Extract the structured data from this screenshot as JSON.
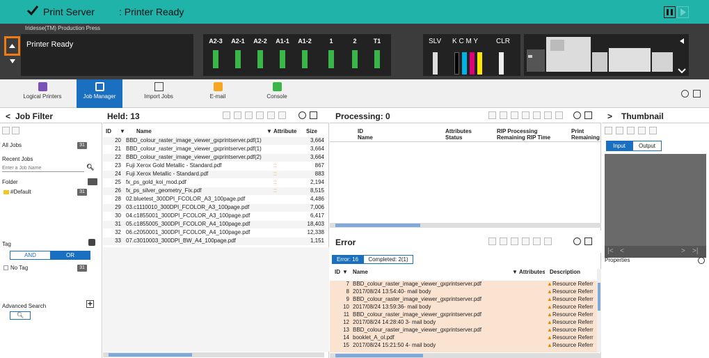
{
  "topbar": {
    "app": "Print Server",
    "status": ": Printer Ready"
  },
  "printer": {
    "model": "Iridesse(TM) Production Press",
    "status": "Printer Ready"
  },
  "trays": [
    "A2-3",
    "A2-1",
    "A2-2",
    "A1-1",
    "A1-2",
    "1",
    "2",
    "T1"
  ],
  "toner": {
    "slv": "SLV",
    "cmyk": "K  C  M  Y",
    "clr": "CLR"
  },
  "tabs": [
    "Logical Printers",
    "Job Manager",
    "Import Jobs",
    "E-mail",
    "Console"
  ],
  "jobfilter": {
    "title": "Job Filter",
    "all_jobs": "All Jobs",
    "all_count": "31",
    "recent": "Recent Jobs",
    "placeholder": "Enter a Job Name",
    "folder": "Folder",
    "default_folder": "#Default",
    "folder_count": "31",
    "tag": "Tag",
    "and": "AND",
    "or": "OR",
    "no_tag": "No Tag",
    "no_tag_count": "31",
    "adv": "Advanced Search"
  },
  "held": {
    "title": "Held: 13",
    "col_id": "ID",
    "col_name": "Name",
    "col_attr": "Attributes",
    "col_size": "Size",
    "rows": [
      {
        "id": "20",
        "name": "BBD_colour_raster_image_viewer_gxprintserver.pdf(1)",
        "attr": "",
        "size": "3,664"
      },
      {
        "id": "21",
        "name": "BBD_colour_raster_image_viewer_gxprintserver.pdf(1)",
        "attr": "",
        "size": "3,664"
      },
      {
        "id": "22",
        "name": "BBD_colour_raster_image_viewer_gxprintserver.pdf(2)",
        "attr": "",
        "size": "3,664"
      },
      {
        "id": "23",
        "name": "Fuji Xerox Gold Metallic - Standard.pdf",
        "attr": "::",
        "size": "867"
      },
      {
        "id": "24",
        "name": "Fuji Xerox Metallic - Standard.pdf",
        "attr": "::",
        "size": "883"
      },
      {
        "id": "25",
        "name": "fx_ps_gold_koi_mod.pdf",
        "attr": "::",
        "size": "2,194"
      },
      {
        "id": "26",
        "name": "fx_ps_silver_geometry_Fix.pdf",
        "attr": "::",
        "size": "8,515"
      },
      {
        "id": "28",
        "name": "02.bluetest_300DPI_FCOLOR_A3_100page.pdf",
        "attr": "",
        "size": "4,486"
      },
      {
        "id": "29",
        "name": "03.c1110010_300DPI_FCOLOR_A3_100page.pdf",
        "attr": "",
        "size": "7,006"
      },
      {
        "id": "30",
        "name": "04.c1855001_300DPI_FCOLOR_A3_100page.pdf",
        "attr": "",
        "size": "6,417"
      },
      {
        "id": "31",
        "name": "05.c1855005_300DPI_FCOLOR_A4_100page.pdf",
        "attr": "",
        "size": "18,403"
      },
      {
        "id": "32",
        "name": "06.c2050001_300DPI_FCOLOR_A4_100page.pdf",
        "attr": "",
        "size": "12,338"
      },
      {
        "id": "33",
        "name": "07.c3010003_300DPI_BW_A4_100page.pdf",
        "attr": "",
        "size": "1,151"
      }
    ]
  },
  "processing": {
    "title": "Processing: 0",
    "c1a": "ID",
    "c1b": "Name",
    "c2a": "Attributes",
    "c2b": "Status",
    "c3a": "RIP Processing",
    "c3b": "Remaining RIP Time",
    "c4a": "Print",
    "c4b": "Remaining"
  },
  "error": {
    "title": "Error",
    "tab_error": "Error: 16",
    "tab_completed": "Completed: 2(1)",
    "col_id": "ID",
    "col_name": "Name",
    "col_attr": "Attributes",
    "col_desc": "Description",
    "rows": [
      {
        "id": "7",
        "name": "BBD_colour_raster_image_viewer_gxprintserver.pdf",
        "desc": "Resource Referr"
      },
      {
        "id": "8",
        "name": "2017/08/24 13:54:40- mail body",
        "desc": "Resource Referr"
      },
      {
        "id": "9",
        "name": "BBD_colour_raster_image_viewer_gxprintserver.pdf",
        "desc": "Resource Referr"
      },
      {
        "id": "10",
        "name": "2017/08/24 13:59:36- mail body",
        "desc": "Resource Referr"
      },
      {
        "id": "11",
        "name": "BBD_colour_raster_image_viewer_gxprintserver.pdf",
        "desc": "Resource Referr"
      },
      {
        "id": "12",
        "name": "2017/08/24 14:28:40 3- mail body",
        "desc": "Resource Referr"
      },
      {
        "id": "13",
        "name": "BBD_colour_raster_image_viewer_gxprintserver.pdf",
        "desc": "Resource Referr"
      },
      {
        "id": "14",
        "name": "booklet_A_ol.pdf",
        "desc": "Resource Referr"
      },
      {
        "id": "15",
        "name": "2017/08/24 15:21:50 4- mail body",
        "desc": "Resource Referr"
      }
    ]
  },
  "thumb": {
    "title": "Thumbnail",
    "input": "Input",
    "output": "Output",
    "properties": "Properties"
  },
  "colors": {
    "topbar": "#1fb3aa",
    "accent": "#1a6fc0",
    "tray_green": "#39b54a",
    "error_row": "#fbe3d2",
    "orange": "#f07b14"
  }
}
